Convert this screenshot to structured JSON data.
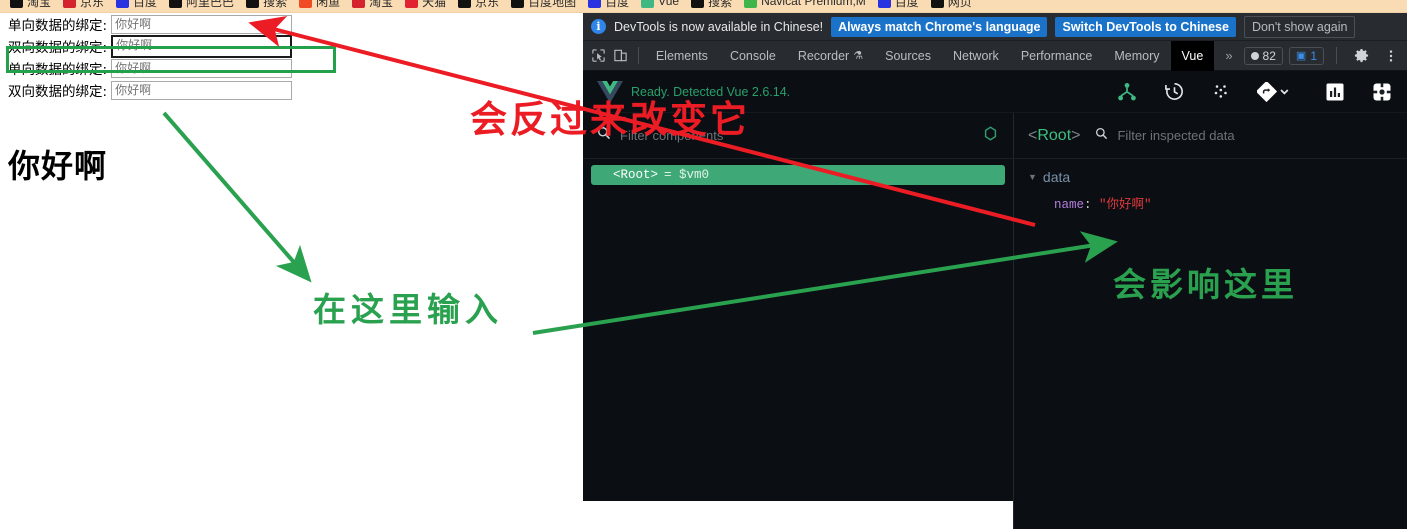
{
  "bookmarks": {
    "items": [
      {
        "label": "淘宝",
        "icon": "taobao-favicon",
        "color": "#111111"
      },
      {
        "label": "京东",
        "icon": "jd-favicon",
        "color": "#d4232f"
      },
      {
        "label": "百度",
        "icon": "baidu-favicon",
        "color": "#2932e1"
      },
      {
        "label": "阿里巴巴",
        "icon": "alibaba-favicon",
        "color": "#111111"
      },
      {
        "label": "搜索",
        "icon": "search-favicon",
        "color": "#111111"
      },
      {
        "label": "闲鱼",
        "icon": "xianyu-favicon",
        "color": "#f04b24"
      },
      {
        "label": "淘宝",
        "icon": "taobao-favicon-2",
        "color": "#d4232f"
      },
      {
        "label": "天猫",
        "icon": "tmall-favicon",
        "color": "#e0232e"
      },
      {
        "label": "京东",
        "icon": "jd-favicon-2",
        "color": "#111111"
      },
      {
        "label": "百度地图",
        "icon": "baidu-map-favicon",
        "color": "#111111"
      },
      {
        "label": "百度",
        "icon": "baidu-favicon-2",
        "color": "#2932e1"
      },
      {
        "label": "Vue",
        "icon": "vue-favicon",
        "color": "#41b883"
      },
      {
        "label": "搜索",
        "icon": "search-favicon-2",
        "color": "#111111"
      },
      {
        "label": "Navicat Premium,M",
        "icon": "navicat-favicon",
        "color": "#3fb54a"
      },
      {
        "label": "百度",
        "icon": "baidu-favicon-3",
        "color": "#2932e1"
      },
      {
        "label": "网页",
        "icon": "web-favicon",
        "color": "#111111"
      }
    ]
  },
  "page": {
    "rows": [
      {
        "label": "单向数据的绑定:",
        "value": "你好啊",
        "focused": false
      },
      {
        "label": "双向数据的绑定:",
        "value": "你好啊",
        "focused": true
      },
      {
        "label": "单向数据的绑定:",
        "value": "你好啊",
        "focused": false
      },
      {
        "label": "双向数据的绑定:",
        "value": "你好啊",
        "focused": false
      }
    ],
    "heading": "你好啊"
  },
  "devtools": {
    "notice": {
      "icon": "info-icon",
      "message": "DevTools is now available in Chinese!",
      "primary_button": "Always match Chrome's language",
      "secondary_button": "Switch DevTools to Chinese",
      "dismiss_button": "Don't show again"
    },
    "tabs": [
      {
        "label": "Elements",
        "active": false
      },
      {
        "label": "Console",
        "active": false
      },
      {
        "label": "Recorder",
        "active": false,
        "flask": true
      },
      {
        "label": "Sources",
        "active": false
      },
      {
        "label": "Network",
        "active": false
      },
      {
        "label": "Performance",
        "active": false
      },
      {
        "label": "Memory",
        "active": false
      },
      {
        "label": "Vue",
        "active": true
      }
    ],
    "overflow_label": "»",
    "badges": {
      "errors": "82",
      "messages": "1"
    },
    "settings_icon": "gear-icon",
    "more_icon": "kebab-menu-icon"
  },
  "vue": {
    "logo": "vue-logo-icon",
    "status": "Ready. Detected Vue 2.6.14.",
    "tools": [
      {
        "name": "component-tree-icon",
        "active": true
      },
      {
        "name": "timeline-history-icon",
        "active": false
      },
      {
        "name": "vuex-icon",
        "active": false
      },
      {
        "name": "router-icon",
        "active": false
      },
      {
        "name": "performance-chart-icon",
        "active": false
      },
      {
        "name": "settings-gear-icon",
        "active": false
      }
    ],
    "components_filter_placeholder": "Filter components",
    "select_component_icon": "target-crosshair-icon",
    "tree": {
      "selected": {
        "brackets_open": "<",
        "name": "Root",
        "brackets_close": ">",
        "binding": "= $vm0"
      }
    },
    "inspector": {
      "root_open": "<",
      "root_name": "Root",
      "root_close": ">",
      "filter_placeholder": "Filter inspected data",
      "section": "data",
      "prop_key": "name",
      "prop_colon": ":",
      "prop_value": "\"你好啊\""
    }
  },
  "annotations": {
    "red_text": "会反过来改变它",
    "green_text_1": "在这里输入",
    "green_text_2": "会影响这里",
    "red_color": "#ec1c24",
    "green_color": "#2aa14f"
  }
}
